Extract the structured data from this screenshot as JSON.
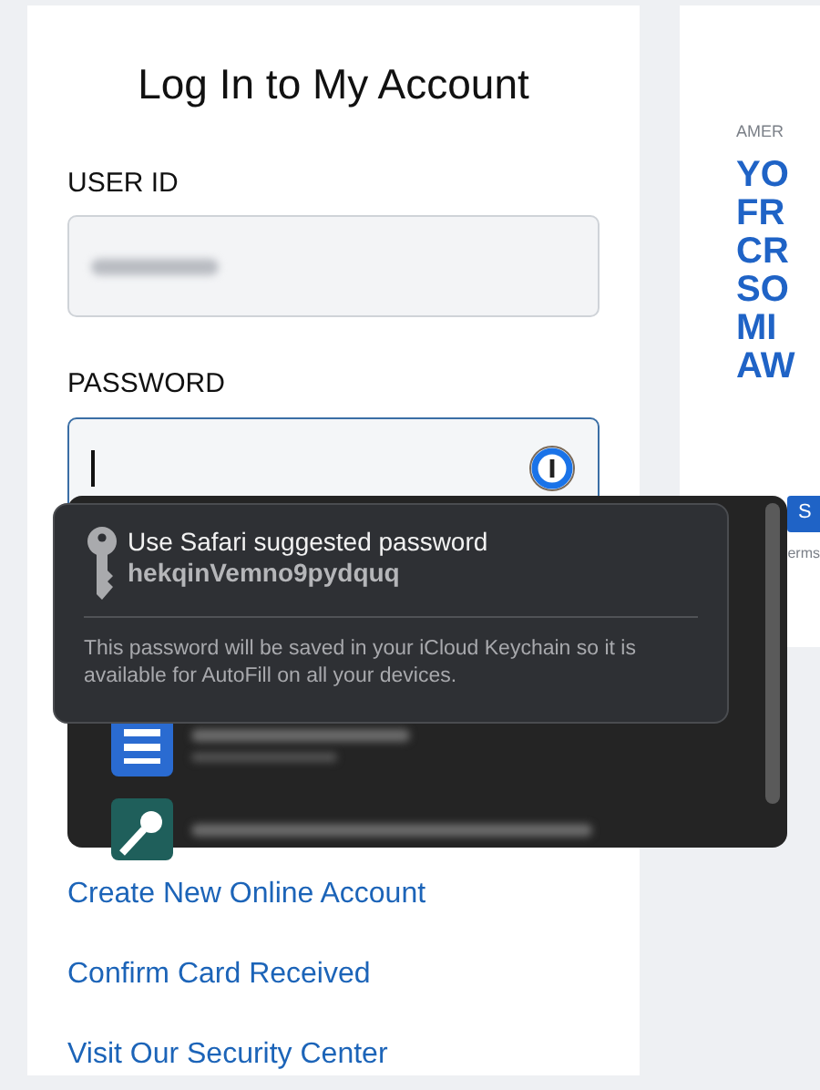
{
  "login": {
    "title": "Log In to My Account",
    "fields": [
      {
        "label": "USER ID",
        "focused": false
      },
      {
        "label": "PASSWORD",
        "focused": true
      }
    ],
    "links": [
      "Create New Online Account",
      "Confirm Card Received",
      "Visit Our Security Center"
    ]
  },
  "promo": {
    "eyebrow": "AMER",
    "headline": [
      "YO",
      "FR",
      "CR",
      "SO",
      "MI",
      "AW"
    ],
    "button": "S",
    "terms": "erms"
  },
  "autofill": {
    "suggestion": {
      "title": "Use Safari suggested password",
      "password": "hekqinVemno9pydquq",
      "note": "This password will be saved in your iCloud Keychain so it is available for AutoFill on all your devices."
    },
    "entries": [
      {
        "kind": "card"
      },
      {
        "kind": "key"
      }
    ]
  }
}
